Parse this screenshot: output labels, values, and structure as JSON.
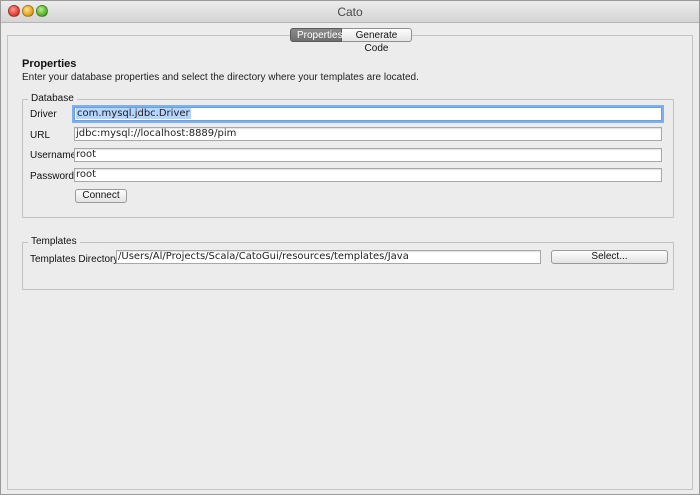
{
  "window": {
    "title": "Cato"
  },
  "tabs": [
    {
      "label": "Properties",
      "active": true
    },
    {
      "label": "Generate Code",
      "active": false
    }
  ],
  "properties": {
    "heading": "Properties",
    "description": "Enter your database properties and select the directory where your templates are located."
  },
  "database": {
    "legend": "Database",
    "driver_label": "Driver",
    "driver_value": "com.mysql.jdbc.Driver",
    "url_label": "URL",
    "url_value": "jdbc:mysql://localhost:8889/pim",
    "username_label": "Username",
    "username_value": "root",
    "password_label": "Password",
    "password_value": "root",
    "connect_label": "Connect"
  },
  "templates": {
    "legend": "Templates",
    "dir_label": "Templates Directory:",
    "dir_value": "/Users/Al/Projects/Scala/CatoGui/resources/templates/Java",
    "select_label": "Select..."
  },
  "colors": {
    "selection": "#b5d4fe",
    "active_tab": "#7a7a7a"
  }
}
